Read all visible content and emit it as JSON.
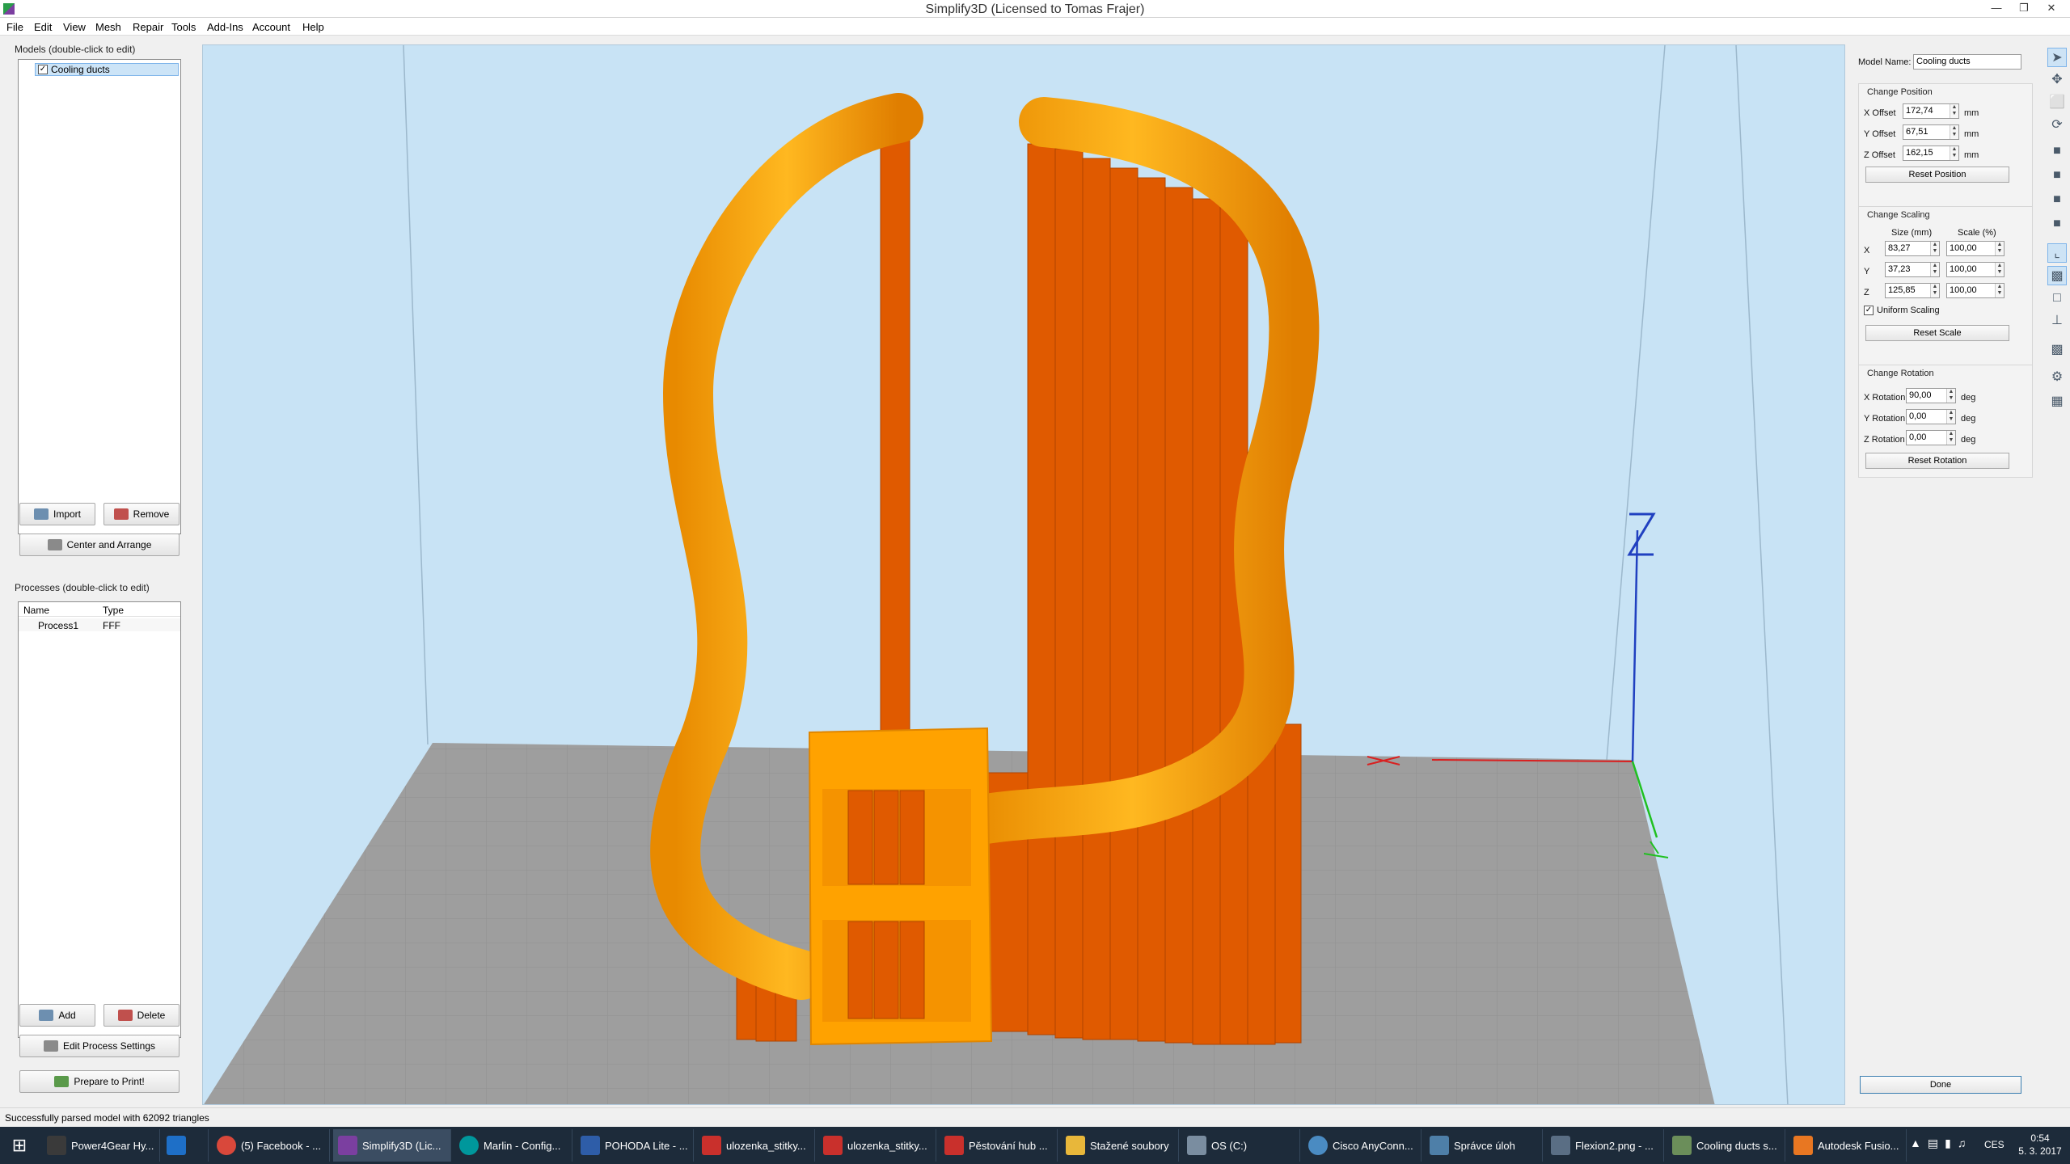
{
  "window": {
    "title": "Simplify3D (Licensed to Tomas Frajer)"
  },
  "menu": [
    "File",
    "Edit",
    "View",
    "Mesh",
    "Repair",
    "Tools",
    "Add-Ins",
    "Account",
    "Help"
  ],
  "models": {
    "label": "Models (double-click to edit)",
    "items": [
      {
        "name": "Cooling ducts",
        "checked": true
      }
    ],
    "import_label": "Import",
    "remove_label": "Remove",
    "center_label": "Center and Arrange"
  },
  "processes": {
    "label": "Processes (double-click to edit)",
    "columns": [
      "Name",
      "Type"
    ],
    "rows": [
      {
        "name": "Process1",
        "type": "FFF"
      }
    ],
    "add_label": "Add",
    "delete_label": "Delete",
    "edit_label": "Edit Process Settings",
    "prepare_label": "Prepare to Print!"
  },
  "model_settings": {
    "name_label": "Model Name:",
    "name_value": "Cooling ducts",
    "position": {
      "label": "Change Position",
      "x_label": "X Offset",
      "x": "172,74",
      "y_label": "Y Offset",
      "y": "67,51",
      "z_label": "Z Offset",
      "z": "162,15",
      "unit": "mm",
      "reset_label": "Reset Position"
    },
    "scaling": {
      "label": "Change Scaling",
      "size_header": "Size (mm)",
      "scale_header": "Scale (%)",
      "rows": [
        {
          "axis": "X",
          "size": "83,27",
          "scale": "100,00"
        },
        {
          "axis": "Y",
          "size": "37,23",
          "scale": "100,00"
        },
        {
          "axis": "Z",
          "size": "125,85",
          "scale": "100,00"
        }
      ],
      "uniform_label": "Uniform Scaling",
      "uniform_checked": true,
      "reset_label": "Reset Scale"
    },
    "rotation": {
      "label": "Change Rotation",
      "x_label": "X Rotation",
      "x": "90,00",
      "y_label": "Y Rotation",
      "y": "0,00",
      "z_label": "Z Rotation",
      "z": "0,00",
      "unit": "deg",
      "reset_label": "Reset Rotation"
    },
    "done_label": "Done"
  },
  "status": {
    "text": "Successfully parsed model with 62092 triangles"
  },
  "taskbar": {
    "items": [
      {
        "label": "Power4Gear Hy...",
        "color": "#3a3a3a"
      },
      {
        "label": "",
        "color": "#1e6fc7"
      },
      {
        "label": "(5) Facebook - ...",
        "color": "#d9483b"
      },
      {
        "label": "Simplify3D (Lic...",
        "color": "#7b3fa0"
      },
      {
        "label": "Marlin - Config...",
        "color": "#00979c"
      },
      {
        "label": "POHODA Lite - ...",
        "color": "#2e5da8"
      },
      {
        "label": "ulozenka_stitky...",
        "color": "#c9302c"
      },
      {
        "label": "ulozenka_stitky...",
        "color": "#c9302c"
      },
      {
        "label": "Pěstování hub ...",
        "color": "#c9302c"
      },
      {
        "label": "Stažené soubory",
        "color": "#e8b73a"
      },
      {
        "label": "OS (C:)",
        "color": "#7a8da0"
      },
      {
        "label": "Cisco AnyConn...",
        "color": "#4a8bc2"
      },
      {
        "label": "Správce úloh",
        "color": "#4e7fa8"
      },
      {
        "label": "Flexion2.png - ...",
        "color": "#5a6e84"
      },
      {
        "label": "Cooling ducts s...",
        "color": "#6b8e5a"
      },
      {
        "label": "Autodesk Fusio...",
        "color": "#e87722"
      }
    ],
    "lang": "CES",
    "time": "0:54",
    "date": "5. 3. 2017"
  },
  "colors": {
    "duct": "#ffa200",
    "support": "#e05a00",
    "bed": "#9e9e9e",
    "sky": "#c8e3f5"
  }
}
